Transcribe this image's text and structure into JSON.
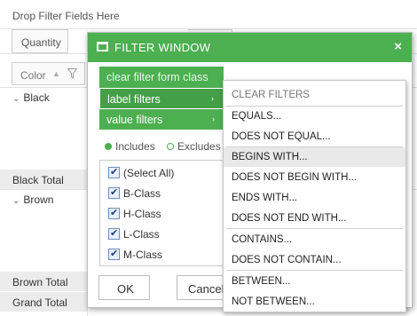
{
  "pivot": {
    "drop_filter_text": "Drop Filter Fields Here",
    "quantity_field": "Quantity",
    "color_field": "Color",
    "rows": {
      "black": "Black",
      "black_total": "Black Total",
      "brown": "Brown",
      "brown_total": "Brown Total",
      "grand_total": "Grand Total"
    }
  },
  "filter_window": {
    "title": "FILTER WINDOW",
    "close_glyph": "×",
    "menu": {
      "clear_label": "clear filter form class",
      "label_filters": "label filters",
      "value_filters": "value filters",
      "arrow_glyph": "›"
    },
    "radio": {
      "includes": "Includes",
      "excludes": "Excludes"
    },
    "members": [
      "(Select All)",
      "B-Class",
      "H-Class",
      "L-Class",
      "M-Class"
    ],
    "ok_label": "OK",
    "cancel_label": "Cancel"
  },
  "submenu": {
    "clear_filters": "CLEAR FILTERS",
    "equals": "EQUALS...",
    "does_not_equal": "DOES NOT EQUAL...",
    "begins_with": "BEGINS WITH...",
    "does_not_begin_with": "DOES NOT BEGIN WITH...",
    "ends_with": "ENDS WITH...",
    "does_not_end_with": "DOES NOT END WITH...",
    "contains": "CONTAINS...",
    "does_not_contain": "DOES NOT CONTAIN...",
    "between": "BETWEEN...",
    "not_between": "NOT BETWEEN..."
  },
  "colors": {
    "accent_green": "#4caf50",
    "hover_gray": "#e9e9e9"
  }
}
